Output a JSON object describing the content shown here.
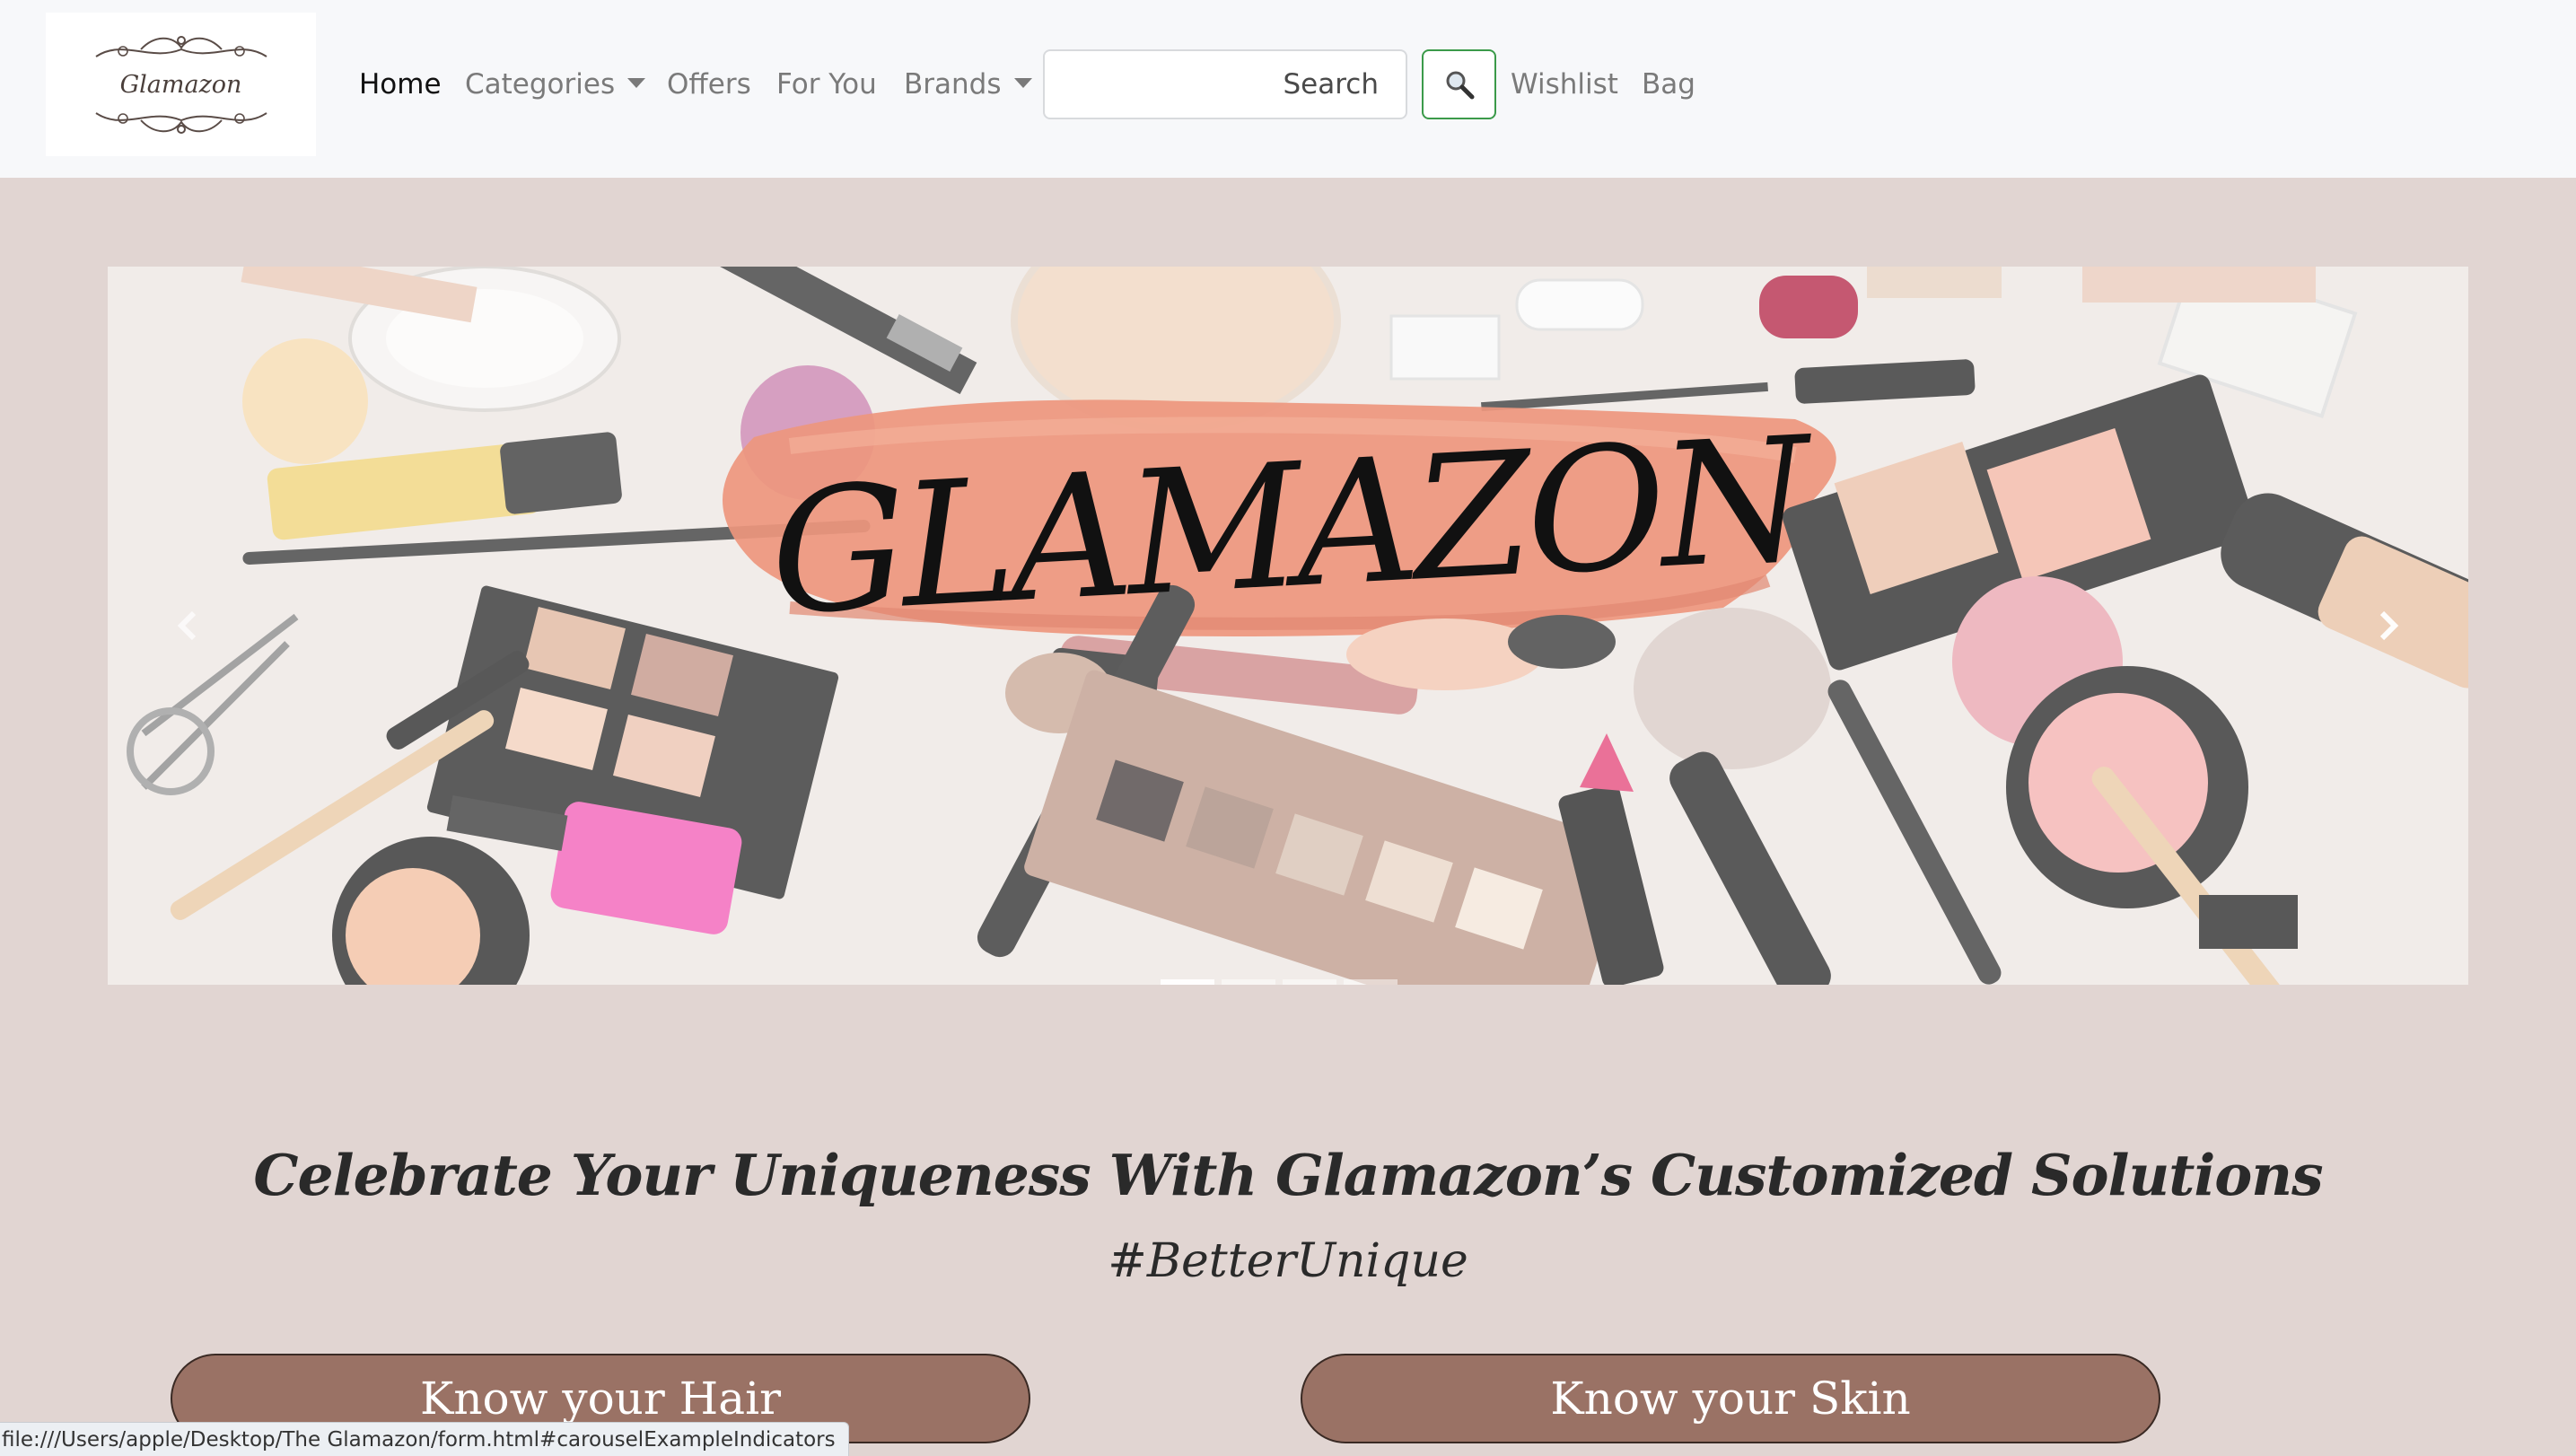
{
  "brand": {
    "logo_text": "Glamazon"
  },
  "nav": {
    "home": "Home",
    "categories": "Categories",
    "offers": "Offers",
    "for_you": "For You",
    "brands": "Brands",
    "wishlist": "Wishlist",
    "bag": "Bag"
  },
  "search": {
    "value": "",
    "placeholder": "Search",
    "button_icon": "magnifier-icon"
  },
  "carousel": {
    "banner_text": "GLAMAZON",
    "slides_count": 4,
    "active_slide": 1
  },
  "hero": {
    "tagline": "Celebrate Your Uniqueness With Glamazon’s Customized Solutions",
    "hashtag": "#BetterUnique"
  },
  "buttons": {
    "hair": "Know your Hair",
    "skin": "Know your Skin"
  },
  "status_bar": {
    "url": "file:///Users/apple/Desktop/The Glamazon/form.html#carouselExampleIndicators"
  },
  "colors": {
    "page_bg": "#e1d5d2",
    "navbar_bg": "#f7f8fa",
    "cta_bg": "#9a7265",
    "search_btn_border": "#3b9a4a",
    "brush_stroke": "#e8795a"
  }
}
